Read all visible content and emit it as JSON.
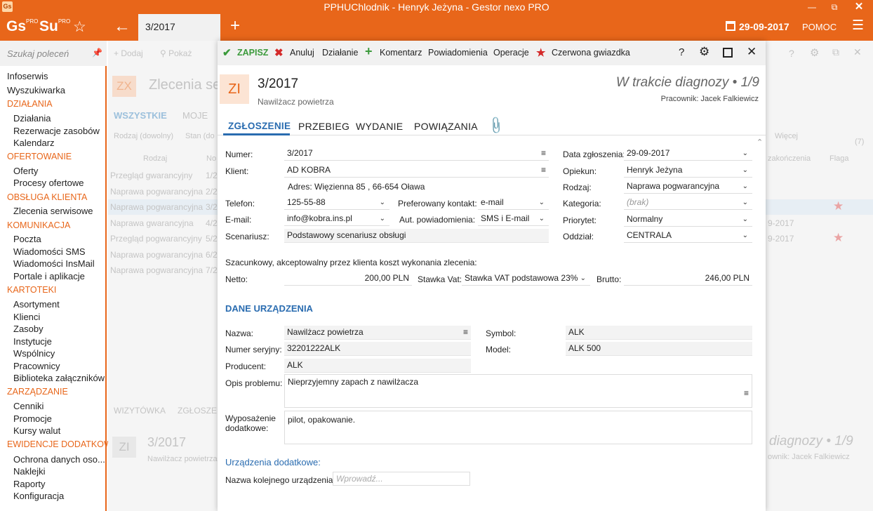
{
  "window": {
    "title": "PPHUChlodnik - Henryk Jeżyna - Gestor nexo PRO",
    "app_icon": "Gs"
  },
  "appbar": {
    "logo1": "Gs",
    "logo1_sup": "PRO",
    "logo2": "Su",
    "logo2_sup": "PRO",
    "doc_tab": "3/2017",
    "date": "29-09-2017",
    "help": "POMOC"
  },
  "sidebar": {
    "search_placeholder": "Szukaj poleceń",
    "items": [
      {
        "label": "Infoserwis",
        "type": "top"
      },
      {
        "label": "Wyszukiwarka",
        "type": "top"
      },
      {
        "label": "DZIAŁANIA",
        "type": "sect"
      },
      {
        "label": "Działania",
        "type": "sub"
      },
      {
        "label": "Rezerwacje zasobów",
        "type": "sub"
      },
      {
        "label": "Kalendarz",
        "type": "sub"
      },
      {
        "label": "OFERTOWANIE",
        "type": "sect"
      },
      {
        "label": "Oferty",
        "type": "sub"
      },
      {
        "label": "Procesy ofertowe",
        "type": "sub"
      },
      {
        "label": "OBSŁUGA KLIENTA",
        "type": "sect"
      },
      {
        "label": "Zlecenia serwisowe",
        "type": "sub"
      },
      {
        "label": "KOMUNIKACJA",
        "type": "sect"
      },
      {
        "label": "Poczta",
        "type": "sub"
      },
      {
        "label": "Wiadomości SMS",
        "type": "sub"
      },
      {
        "label": "Wiadomości InsMail",
        "type": "sub"
      },
      {
        "label": "Portale i aplikacje",
        "type": "sub"
      },
      {
        "label": "KARTOTEKI",
        "type": "sect"
      },
      {
        "label": "Asortyment",
        "type": "sub"
      },
      {
        "label": "Klienci",
        "type": "sub"
      },
      {
        "label": "Zasoby",
        "type": "sub"
      },
      {
        "label": "Instytucje",
        "type": "sub"
      },
      {
        "label": "Wspólnicy",
        "type": "sub"
      },
      {
        "label": "Pracownicy",
        "type": "sub"
      },
      {
        "label": "Biblioteka załączników",
        "type": "sub"
      },
      {
        "label": "ZARZĄDZANIE",
        "type": "sect"
      },
      {
        "label": "Cenniki",
        "type": "sub"
      },
      {
        "label": "Promocje",
        "type": "sub"
      },
      {
        "label": "Kursy walut",
        "type": "sub"
      },
      {
        "label": "EWIDENCJE DODATKOWE",
        "type": "sect"
      },
      {
        "label": "Ochrona danych oso...",
        "type": "sub"
      },
      {
        "label": "Naklejki",
        "type": "sub"
      },
      {
        "label": "Raporty",
        "type": "sub"
      },
      {
        "label": "Konfiguracja",
        "type": "sub"
      }
    ]
  },
  "background": {
    "toolbar": {
      "add": "Dodaj",
      "show": "Pokaż"
    },
    "zx": "ZX",
    "title": "Zlecenia se",
    "tabs": [
      "WSZYSTKIE",
      "MOJE"
    ],
    "filters": [
      "Rodzaj (dowolny)",
      "Stan (do"
    ],
    "col_rodzaj": "Rodzaj",
    "col_no": "No",
    "more": "Więcej",
    "count": "(7)",
    "col_zakonczenia": "zakończenia",
    "col_flaga": "Flaga",
    "rows": [
      {
        "rodzaj": "Przegląd gwarancyjny",
        "no": "1/2",
        "date": "",
        "star": false
      },
      {
        "rodzaj": "Naprawa pogwarancyjna",
        "no": "2/2",
        "date": "",
        "star": false
      },
      {
        "rodzaj": "Naprawa pogwarancyjna",
        "no": "3/2",
        "date": "",
        "star": true
      },
      {
        "rodzaj": "Naprawa gwarancyjna",
        "no": "4/2",
        "date": "9-2017",
        "star": false
      },
      {
        "rodzaj": "Przegląd pogwarancyjny",
        "no": "5/2",
        "date": "9-2017",
        "star": true
      },
      {
        "rodzaj": "Naprawa pogwarancyjna",
        "no": "6/2",
        "date": "",
        "star": false
      },
      {
        "rodzaj": "Naprawa pogwarancyjna",
        "no": "7/2",
        "date": "",
        "star": false
      }
    ],
    "bottom_tabs": [
      "WIZYTÓWKA",
      "ZGŁOSZEN"
    ],
    "bottom_zi": "ZI",
    "bottom_no": "3/2017",
    "bottom_sub": "Nawilżacz powietrza",
    "bottom_status": "diagnozy • 1/9",
    "bottom_worker": "ownik: Jacek Falkiewicz"
  },
  "dialog": {
    "toolbar": {
      "save": "ZAPISZ",
      "cancel": "Anuluj",
      "action": "Działanie",
      "comment": "Komentarz",
      "notifications": "Powiadomienia",
      "operations": "Operacje",
      "red_star": "Czerwona gwiazdka"
    },
    "header": {
      "badge": "ZI",
      "number": "3/2017",
      "subtitle": "Nawilżacz powietrza",
      "status": "W trakcie diagnozy • 1/9",
      "worker": "Pracownik: Jacek Falkiewicz"
    },
    "tabs": [
      "ZGŁOSZENIE",
      "PRZEBIEG",
      "WYDANIE",
      "POWIĄZANIA"
    ],
    "form": {
      "numer_label": "Numer:",
      "numer": "3/2017",
      "klient_label": "Klient:",
      "klient": "AD KOBRA",
      "adres": "Adres:  Więzienna  85 , 66-654 Oława",
      "telefon_label": "Telefon:",
      "telefon": "125-55-88",
      "pref_label": "Preferowany kontakt:",
      "pref": "e-mail",
      "email_label": "E-mail:",
      "email": "info@kobra.ins.pl",
      "aut_label": "Aut. powiadomienia:",
      "aut": "SMS i E-mail",
      "scen_label": "Scenariusz:",
      "scen": "Podstawowy scenariusz obsługi",
      "data_label": "Data zgłoszenia:",
      "data": "29-09-2017",
      "opiekun_label": "Opiekun:",
      "opiekun": "Henryk Jeżyna",
      "rodzaj_label": "Rodzaj:",
      "rodzaj": "Naprawa pogwarancyjna",
      "kategoria_label": "Kategoria:",
      "kategoria": "(brak)",
      "priorytet_label": "Priorytet:",
      "priorytet": "Normalny",
      "oddzial_label": "Oddział:",
      "oddzial": "CENTRALA",
      "koszt_label": "Szacunkowy, akceptowalny przez klienta koszt wykonania zlecenia:",
      "netto_label": "Netto:",
      "netto": "200,00 PLN",
      "vat_label": "Stawka Vat:",
      "vat": "Stawka VAT podstawowa 23%",
      "brutto_label": "Brutto:",
      "brutto": "246,00 PLN"
    },
    "device": {
      "section": "DANE URZĄDZENIA",
      "nazwa_label": "Nazwa:",
      "nazwa": "Nawilżacz powietrza",
      "symbol_label": "Symbol:",
      "symbol": "ALK",
      "seryjny_label": "Numer seryjny:",
      "seryjny": "32201222ALK",
      "model_label": "Model:",
      "model": "ALK 500",
      "producent_label": "Producent:",
      "producent": "ALK",
      "opis_label": "Opis problemu:",
      "opis": "Nieprzyjemny zapach z nawilżacza",
      "wyp_label1": "Wyposażenie",
      "wyp_label2": "dodatkowe:",
      "wyp": "pilot, opakowanie.",
      "extra_title": "Urządzenia dodatkowe:",
      "next_label": "Nazwa kolejnego urządzenia:",
      "next_placeholder": "Wprowadź..."
    }
  }
}
